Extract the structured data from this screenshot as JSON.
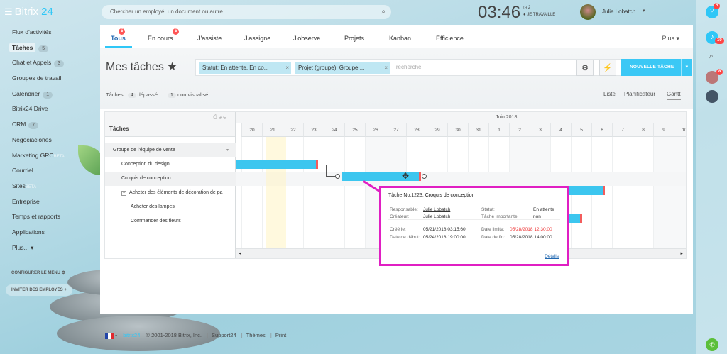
{
  "app": {
    "brand_name": "Bitrix",
    "brand_num": "24",
    "burger_icon": "☰"
  },
  "search": {
    "placeholder": "Chercher un employé, un document ou autre..."
  },
  "header": {
    "clock": "03:46",
    "clock_sup": "2",
    "work_status": "JE TRAVAILLE",
    "user_name": "Julie Lobatch"
  },
  "sidebar": {
    "items": [
      {
        "label": "Flux d'activités",
        "count": ""
      },
      {
        "label": "Tâches",
        "count": "5"
      },
      {
        "label": "Chat et Appels",
        "count": "3"
      },
      {
        "label": "Groupes de travail",
        "count": ""
      },
      {
        "label": "Calendrier",
        "count": "1"
      },
      {
        "label": "Bitrix24.Drive",
        "count": ""
      },
      {
        "label": "CRM",
        "count": "7"
      },
      {
        "label": "Negociaciones",
        "count": ""
      },
      {
        "label": "Marketing GRC",
        "count": "",
        "faint": "BETA"
      },
      {
        "label": "Courriel",
        "count": ""
      },
      {
        "label": "Sites",
        "count": "",
        "faint": "BETA"
      },
      {
        "label": "Entreprise",
        "count": ""
      },
      {
        "label": "Temps et rapports",
        "count": ""
      },
      {
        "label": "Applications",
        "count": ""
      },
      {
        "label": "Plus...",
        "count": ""
      }
    ],
    "config_menu": "CONFIGURER LE MENU",
    "invite": "INVITER DES EMPLOYÉS"
  },
  "tabs": {
    "items": [
      {
        "label": "Tous",
        "badge": "5"
      },
      {
        "label": "En cours",
        "badge": "5"
      },
      {
        "label": "J'assiste",
        "badge": ""
      },
      {
        "label": "J'assigne",
        "badge": ""
      },
      {
        "label": "J'observe",
        "badge": ""
      },
      {
        "label": "Projets",
        "badge": ""
      },
      {
        "label": "Kanban",
        "badge": ""
      },
      {
        "label": "Efficience",
        "badge": ""
      }
    ],
    "more": "Plus"
  },
  "page": {
    "title": "Mes tâches",
    "star": "★"
  },
  "filter": {
    "chip1": "Statut: En attente, En co...",
    "chip2": "Projet (groupe): Groupe ...",
    "search_placeholder": "+ recherche"
  },
  "toolbar": {
    "new_task": "NOUVELLE TÂCHE",
    "gear": "⚙",
    "bolt": "⚡"
  },
  "counters": {
    "label": "Tâches:",
    "overdue_count": "4",
    "overdue_label": "dépassé",
    "unseen_count": "1",
    "unseen_label": "non visualisé"
  },
  "views": {
    "list": "Liste",
    "planner": "Planificateur",
    "gantt": "Gantt"
  },
  "gantt": {
    "column_header": "Tâches",
    "month": "Juin 2018",
    "days": [
      "20",
      "21",
      "22",
      "23",
      "24",
      "25",
      "26",
      "27",
      "28",
      "29",
      "30",
      "31",
      "1",
      "2",
      "3",
      "4",
      "5",
      "6",
      "7",
      "8",
      "9",
      "10"
    ],
    "rows": [
      {
        "label": "Groupe de l'équipe de vente"
      },
      {
        "label": "Conception du design"
      },
      {
        "label": "Croquis de conception"
      },
      {
        "label": "Acheter des éléments de décoration de pa"
      },
      {
        "label": "Acheter des lampes"
      },
      {
        "label": "Commander des fleurs"
      }
    ]
  },
  "popup": {
    "title_prefix": "Tâche No.1223:",
    "title": "Croquis de conception",
    "responsible_label": "Responsable:",
    "responsible": "Julie Lobatch",
    "creator_label": "Créateur:",
    "creator": "Julie Lobatch",
    "status_label": "Statut:",
    "status": "En attente",
    "important_label": "Tâche importante:",
    "important": "non",
    "created_label": "Créé le:",
    "created": "05/21/2018 03:15:60",
    "start_label": "Date de début:",
    "start": "05/24/2018 19:00:00",
    "deadline_label": "Date limite:",
    "deadline": "05/28/2018 12:30:00",
    "end_label": "Date de fin:",
    "end": "05/28/2018 14:00:00",
    "details": "Détails"
  },
  "footer": {
    "brand": "bitrix24",
    "copyright": "© 2001-2018 Bitrix, Inc.",
    "support": "Support24",
    "themes": "Thèmes",
    "print": "Print"
  },
  "colors": {
    "accent": "#3bc8f5",
    "popup_border": "#e01fc3",
    "bar": "#3cc6ef",
    "deadline": "#f35c5c"
  }
}
